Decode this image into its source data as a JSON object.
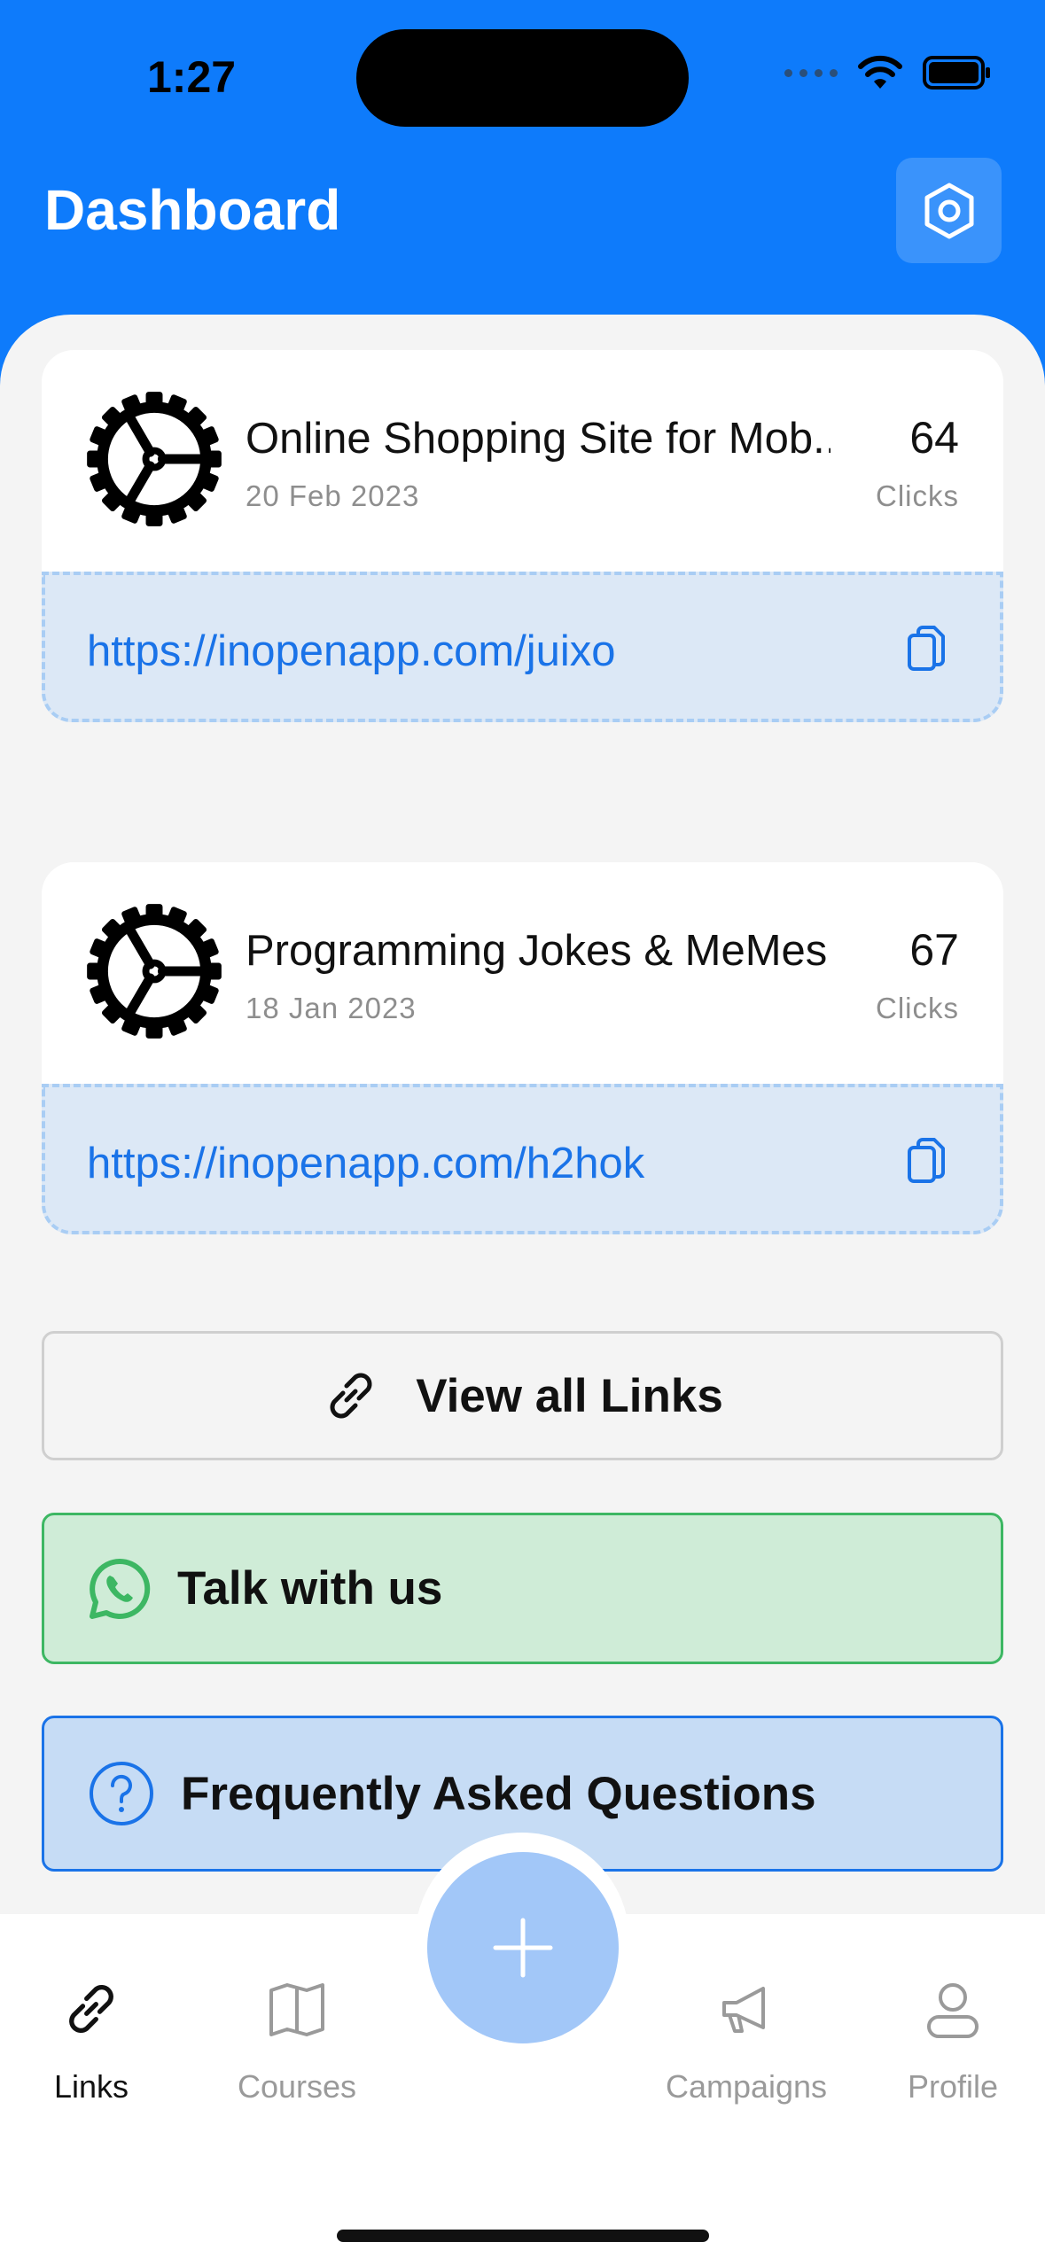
{
  "status_bar": {
    "time": "1:27"
  },
  "header": {
    "title": "Dashboard"
  },
  "links": [
    {
      "title": "Online Shopping Site for Mob...",
      "date": "20 Feb 2023",
      "count": "64",
      "count_label": "Clicks",
      "url": "https://inopenapp.com/juixo"
    },
    {
      "title": "Programming Jokes & MeMes...",
      "date": "18 Jan 2023",
      "count": "67",
      "count_label": "Clicks",
      "url": "https://inopenapp.com/h2hok"
    }
  ],
  "actions": {
    "view_all": "View all Links",
    "talk": "Talk with us",
    "faq": "Frequently Asked Questions"
  },
  "tabbar": {
    "items": [
      {
        "label": "Links",
        "icon": "link-icon",
        "active": true
      },
      {
        "label": "Courses",
        "icon": "book-icon",
        "active": false
      },
      {
        "label": "Campaigns",
        "icon": "megaphone-icon",
        "active": false
      },
      {
        "label": "Profile",
        "icon": "user-icon",
        "active": false
      }
    ],
    "fab_icon": "plus-icon"
  },
  "colors": {
    "primary": "#0e7bfb",
    "link": "#1a73e8",
    "whatsapp_green": "#3db763",
    "fab": "#a2c7f8"
  }
}
